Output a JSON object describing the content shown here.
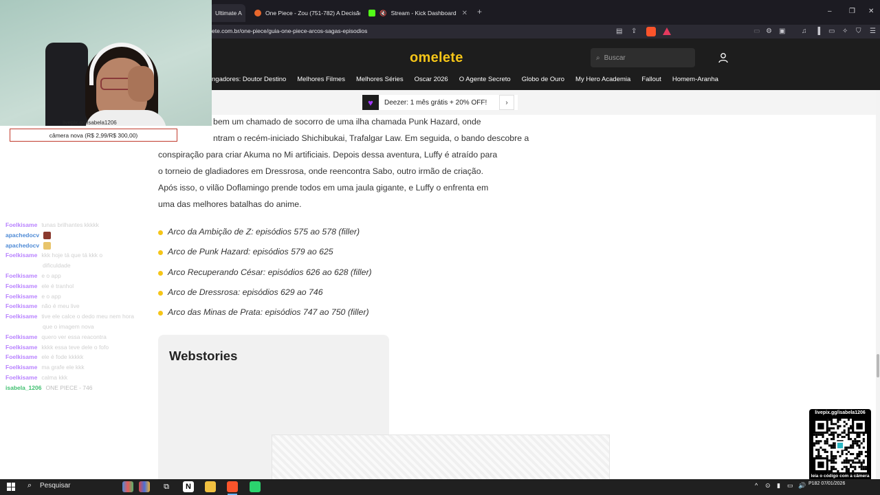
{
  "browser": {
    "tabs": [
      {
        "label": "Ultimate A",
        "favicon_color": "#4a4a4a",
        "active": true
      },
      {
        "label": "One Piece - Zou (751-782) A Decisão",
        "favicon_color": "#e8672c",
        "active": false
      },
      {
        "label": "Stream - Kick Dashboard",
        "favicon_color": "#53fc18",
        "active": false
      }
    ],
    "new_tab": "+",
    "url": "ete.com.br/one-piece/guia-one-piece-arcos-sagas-episodios",
    "window_controls": {
      "minimize": "–",
      "maximize": "❐",
      "close": "✕"
    }
  },
  "site": {
    "logo": "omelete",
    "search_placeholder": "Buscar",
    "nav": [
      "ngadores: Doutor Destino",
      "Melhores Filmes",
      "Melhores Séries",
      "Oscar 2026",
      "O Agente Secreto",
      "Globo de Ouro",
      "My Hero Academia",
      "Fallout",
      "Homem-Aranha"
    ],
    "promo": {
      "text": "Deezer: 1 mês grátis + 20% OFF!",
      "arrow": "›",
      "brand_color": "#a238ff"
    },
    "accent_color": "#f5c518"
  },
  "article": {
    "paragraph_lines": [
      "bem um chamado de socorro de uma ilha chamada Punk Hazard, onde",
      "ntram o recém-iniciado Shichibukai, Trafalgar Law. Em seguida, o bando descobre a",
      "conspiração para criar Akuma no Mi artificiais. Depois dessa aventura, Luffy é atraído para",
      "o torneio de gladiadores em Dressrosa, onde reencontra Sabo, outro irmão de criação.",
      "Após isso, o vilão Doflamingo prende todos em uma jaula gigante, e Luffy o enfrenta em",
      "uma das melhores batalhas do anime."
    ],
    "arcs": [
      "Arco da Ambição de Z: episódios 575 ao 578 (filler)",
      "Arco de Punk Hazard: episódios 579 ao 625",
      "Arco Recuperando César: episódios 626 ao 628 (filler)",
      "Arco de Dressrosa: episódios 629 ao 746",
      "Arco das Minas de Prata: episódios 747 ao 750 (filler)"
    ],
    "webstories_title": "Webstories"
  },
  "stream_overlay": {
    "cam_label": "livepix.gg/isabela1206",
    "donation_goal": "câmera nova (R$ 2,99/R$ 300,00)",
    "chat": [
      {
        "user": "Foelkisame",
        "msg": "tunas brilhantes kkkkk",
        "color": "#b983ff"
      },
      {
        "user": "apachedocv",
        "msg": "",
        "color": "#4f8bd6",
        "emote_color": "#8b3a2e"
      },
      {
        "user": "apachedocv",
        "msg": "",
        "color": "#4f8bd6",
        "emote_color": "#e8c46a"
      },
      {
        "user": "Foelkisame",
        "msg": "kkk hoje tá que tá kkk o",
        "color": "#b983ff"
      },
      {
        "user": "",
        "msg": "dificuldade",
        "color": "#b983ff"
      },
      {
        "user": "Foelkisame",
        "msg": "e o app",
        "color": "#b983ff"
      },
      {
        "user": "Foelkisame",
        "msg": "ele é tranhol",
        "color": "#b983ff"
      },
      {
        "user": "Foelkisame",
        "msg": "e o app",
        "color": "#b983ff"
      },
      {
        "user": "Foelkisame",
        "msg": "não é meu live",
        "color": "#b983ff"
      },
      {
        "user": "Foelkisame",
        "msg": "tive ele calce o dedo meu nem hora",
        "color": "#b983ff"
      },
      {
        "user": "",
        "msg": "que o imagem nova",
        "color": "#b983ff"
      },
      {
        "user": "Foelkisame",
        "msg": "quero ver essa reacontra",
        "color": "#b983ff"
      },
      {
        "user": "Foelkisame",
        "msg": "kkkk essa teve dele o fofo",
        "color": "#b983ff"
      },
      {
        "user": "Foelkisame",
        "msg": "ele é fode kkkkk",
        "color": "#b983ff"
      },
      {
        "user": "Foelkisame",
        "msg": "ma grafe ele kkk",
        "color": "#b983ff"
      },
      {
        "user": "Foelkisame",
        "msg": "calma kkk",
        "color": "#b983ff"
      },
      {
        "user": "isabela_1206",
        "msg": "ONE PIECE - 746",
        "color": "#3fbf6f"
      }
    ],
    "qr_title": "livepix.gg/isabela1206",
    "qr_note": "leia o código com a câmera do celular."
  },
  "taskbar": {
    "search_label": "Pesquisar",
    "clock_time": "P182",
    "clock_date": "07/01/2026"
  }
}
